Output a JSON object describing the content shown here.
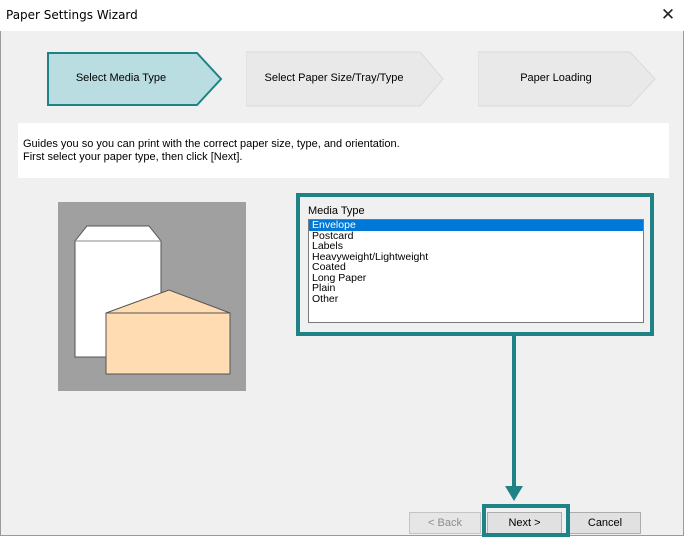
{
  "window": {
    "title": "Paper Settings Wizard",
    "close_glyph": "✕"
  },
  "steps": [
    {
      "label": "Select Media Type",
      "state": "active"
    },
    {
      "label": "Select Paper Size/Tray/Type",
      "state": "inactive"
    },
    {
      "label": "Paper Loading",
      "state": "inactive"
    }
  ],
  "description": {
    "line1": "Guides you so you can print with the correct paper size, type, and orientation.",
    "line2": "First select your paper type, then click [Next]."
  },
  "media_type": {
    "label": "Media Type",
    "options": [
      "Envelope",
      "Postcard",
      "Labels",
      "Heavyweight/Lightweight",
      "Coated",
      "Long Paper",
      "Plain",
      "Other"
    ],
    "selected": "Envelope"
  },
  "buttons": {
    "back": "< Back",
    "next": "Next >",
    "cancel": "Cancel"
  },
  "colors": {
    "highlight": "#1f8386",
    "active_step_fill": "#b9dde0",
    "inactive_step_fill": "#e9e9e9",
    "selection": "#0078d7",
    "envelope_fill": "#ffdcb2"
  },
  "icons": {
    "illustration": "envelope-over-paper-illustration",
    "annotation_arrow": "down-arrow-icon"
  }
}
